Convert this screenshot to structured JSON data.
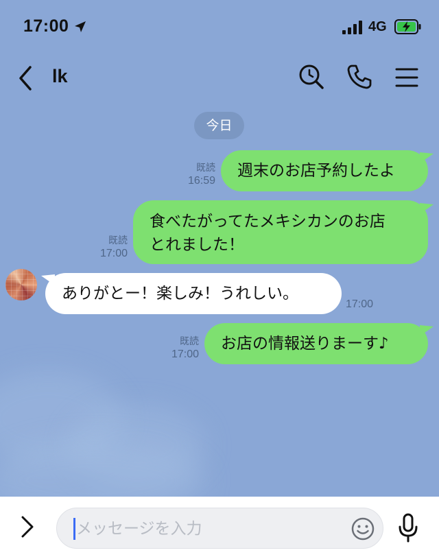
{
  "status_bar": {
    "time": "17:00",
    "network": "4G",
    "icons": [
      "location-arrow-icon",
      "signal-bars-icon",
      "battery-charging-icon"
    ]
  },
  "header": {
    "title": "lk",
    "icons": [
      "back-chevron-icon",
      "search-icon",
      "phone-icon",
      "menu-icon"
    ]
  },
  "date_separator": "今日",
  "messages": [
    {
      "side": "right",
      "text_lines": [
        "週末のお店予約したよ"
      ],
      "read": "既読",
      "time": "16:59"
    },
    {
      "side": "right",
      "text_lines": [
        "食べたがってたメキシカンのお店",
        "とれました！"
      ],
      "read": "既読",
      "time": "17:00"
    },
    {
      "side": "left",
      "text_lines": [
        "ありがとー！楽しみ！うれしい。"
      ],
      "time": "17:00"
    },
    {
      "side": "right",
      "text_lines": [
        "お店の情報送りまーす♪"
      ],
      "read": "既読",
      "time": "17:00"
    }
  ],
  "input": {
    "placeholder": "メッセージを入力",
    "icons": [
      "expand-chevron-icon",
      "emoji-smile-icon",
      "microphone-icon"
    ]
  },
  "colors": {
    "chat_background": "#8aa7d6",
    "outgoing_bubble": "#7ee070",
    "incoming_bubble": "#ffffff",
    "date_pill": "#7b97c2",
    "caret": "#3b6cf5"
  }
}
